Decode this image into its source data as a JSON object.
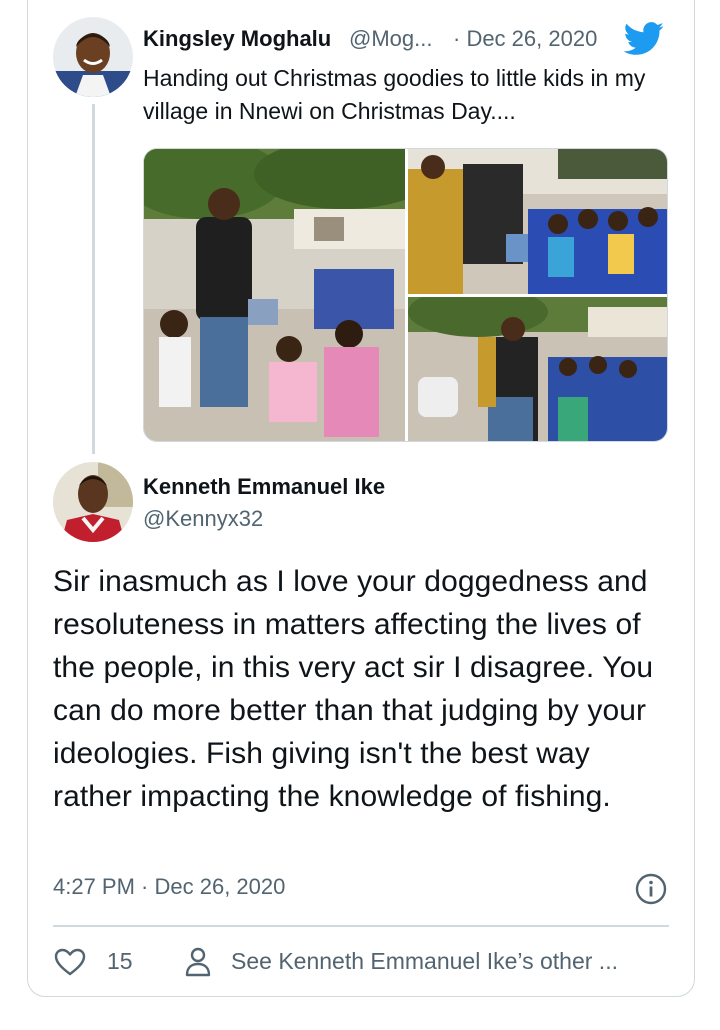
{
  "parent_tweet": {
    "author_name": "Kingsley Moghalu",
    "author_handle": "@Mog...",
    "separator_date": "· Dec 26, 2020",
    "text": "Handing out Christmas goodies to little kids in my village in Nnewi on Christmas Day....",
    "media_count": 3
  },
  "main_tweet": {
    "author_name": "Kenneth Emmanuel Ike",
    "author_handle": "@Kennyx32",
    "text": "Sir inasmuch as I love your doggedness and resoluteness in matters affecting the lives of the people, in this very act sir I disagree. You can do more better than that judging by your ideologies. Fish giving isn't the best way rather impacting the knowledge of fishing.",
    "timestamp": "4:27 PM · Dec 26, 2020"
  },
  "actions": {
    "like_count": "15",
    "see_others_label": "See Kenneth Emmanuel Ike’s other ..."
  },
  "icons": {
    "brand": "twitter-bird-icon",
    "info": "info-icon",
    "like": "heart-icon",
    "profile": "person-icon"
  },
  "colors": {
    "twitter_blue": "#1d9bf0",
    "text_primary": "#0f1419",
    "text_secondary": "#536471",
    "border": "#cfd9de"
  }
}
